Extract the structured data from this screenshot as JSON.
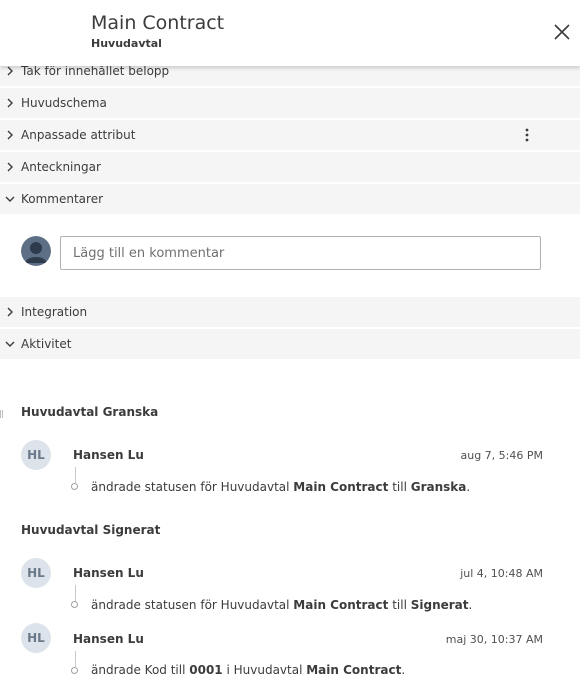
{
  "header": {
    "title": "Main Contract",
    "subtitle": "Huvudavtal"
  },
  "sections": {
    "tak": "Tak för innehållet belopp",
    "huvudschema": "Huvudschema",
    "anpassade": "Anpassade attribut",
    "anteckningar": "Anteckningar",
    "kommentarer": "Kommentarer",
    "integration": "Integration",
    "aktivitet": "Aktivitet"
  },
  "comment": {
    "placeholder": "Lägg till en kommentar"
  },
  "activity": {
    "groups": [
      {
        "title": "Huvudavtal Granska",
        "entries": [
          {
            "initials": "HL",
            "user": "Hansen Lu",
            "time": "aug 7, 5:46 PM",
            "parts": [
              "ändrade statusen för Huvudavtal ",
              "Main Contract",
              " till ",
              "Granska",
              "."
            ]
          }
        ]
      },
      {
        "title": "Huvudavtal Signerat",
        "entries": [
          {
            "initials": "HL",
            "user": "Hansen Lu",
            "time": "jul 4, 10:48 AM",
            "parts": [
              "ändrade statusen för Huvudavtal ",
              "Main Contract",
              " till ",
              "Signerat",
              "."
            ]
          },
          {
            "initials": "HL",
            "user": "Hansen Lu",
            "time": "maj 30, 10:37 AM",
            "parts": [
              "ändrade Kod till ",
              "0001",
              " i Huvudavtal ",
              "Main Contract",
              "."
            ]
          }
        ]
      }
    ]
  }
}
